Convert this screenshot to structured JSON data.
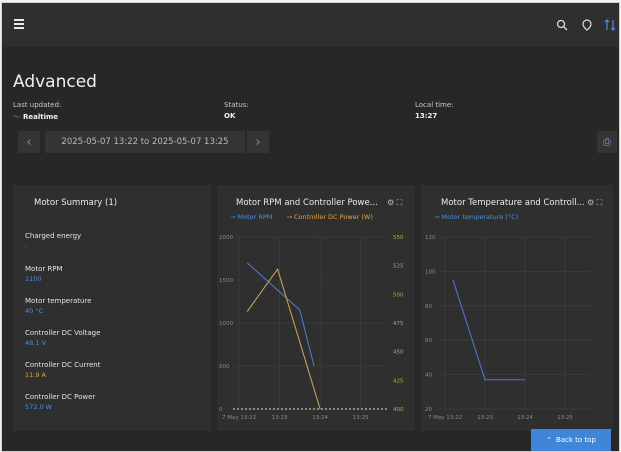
{
  "header": {
    "title": "Advanced",
    "last_updated_label": "Last updated:",
    "last_updated_value": "Realtime",
    "status_label": "Status:",
    "status_value": "OK",
    "local_time_label": "Local time:",
    "local_time_value": "13:27"
  },
  "toolbar": {
    "prev": "‹",
    "next": "›",
    "range": "2025-05-07 13:22 to 2025-05-07 13:25"
  },
  "summary": {
    "title": "Motor Summary (1)",
    "items": [
      {
        "label": "Charged energy",
        "value": "-"
      },
      {
        "label": "Motor RPM",
        "value": "1100"
      },
      {
        "label": "Motor temperature",
        "value": "40 °C"
      },
      {
        "label": "Controller DC Voltage",
        "value": "48.1 V"
      },
      {
        "label": "Controller DC Current",
        "value": "11.9 A"
      },
      {
        "label": "Controller DC Power",
        "value": "572.0 W"
      }
    ],
    "colors": [
      "#4d8fe0",
      "#4d8fe0",
      "#4d8fe0",
      "#4d8fe0",
      "#e0a53a",
      "#4d8fe0"
    ]
  },
  "chart_rpm": {
    "title": "Motor RPM and Controller Powe...",
    "legend_rpm": "Motor RPM",
    "legend_power": "Controller DC Power (W)"
  },
  "chart_temp": {
    "title": "Motor Temperature and Controll...",
    "legend_temp": "Motor temperature (°C)"
  },
  "back_to_top": "Back to top",
  "chart_data": [
    {
      "type": "line",
      "title": "Motor RPM and Controller Powe...",
      "x": [
        "7 May 13:22",
        "13:23",
        "13:24",
        "13:25"
      ],
      "y_left_ticks": [
        0,
        500,
        1000,
        1500,
        2000
      ],
      "y_right_ticks": [
        400,
        425,
        450,
        475,
        500,
        525,
        550
      ],
      "series": [
        {
          "name": "Motor RPM",
          "axis": "left",
          "color": "#4a78c9",
          "points": [
            [
              0.2,
              1700
            ],
            [
              1.5,
              1150
            ],
            [
              1.85,
              500
            ]
          ]
        },
        {
          "name": "Controller DC Power (W)",
          "axis": "right",
          "color": "#c4a257",
          "points": [
            [
              0.2,
              485
            ],
            [
              0.95,
              522
            ],
            [
              2.0,
              400
            ]
          ]
        }
      ]
    },
    {
      "type": "line",
      "title": "Motor Temperature and Controll...",
      "x": [
        "7 May 13:22",
        "13:23",
        "13:24",
        "13:25"
      ],
      "y_ticks": [
        20,
        40,
        60,
        80,
        100,
        120
      ],
      "series": [
        {
          "name": "Motor temperature (°C)",
          "color": "#4a78c9",
          "points": [
            [
              0.2,
              95
            ],
            [
              1.0,
              37
            ],
            [
              2.0,
              37
            ]
          ]
        }
      ]
    }
  ]
}
